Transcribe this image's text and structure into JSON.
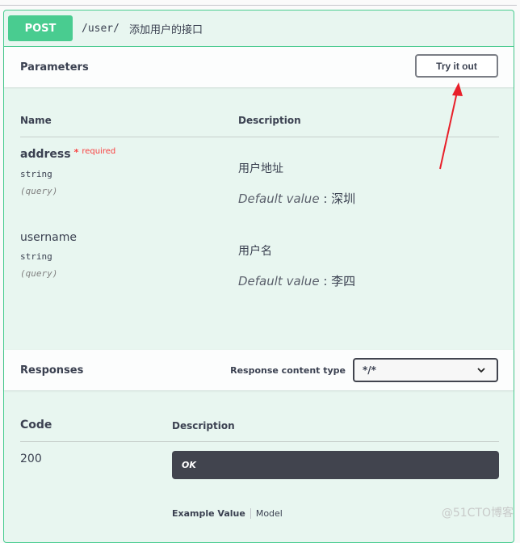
{
  "operation": {
    "method": "POST",
    "path": "/user/",
    "summary": "添加用户的接口",
    "colors": {
      "method_bg": "#49cc90",
      "block_bg": "#e8f6f0",
      "required": "#f93e3e"
    }
  },
  "parameters": {
    "title": "Parameters",
    "try_it_out_label": "Try it out",
    "columns": {
      "name": "Name",
      "description": "Description"
    },
    "items": [
      {
        "name": "address",
        "required_mark": "*",
        "required_label": "required",
        "type": "string",
        "in": "(query)",
        "description": "用户地址",
        "default_label": "Default value",
        "default_value": "深圳"
      },
      {
        "name": "username",
        "type": "string",
        "in": "(query)",
        "description": "用户名",
        "default_label": "Default value",
        "default_value": "李四"
      }
    ]
  },
  "responses": {
    "title": "Responses",
    "content_type_label": "Response content type",
    "content_type_value": "*/*",
    "columns": {
      "code": "Code",
      "description": "Description"
    },
    "items": [
      {
        "code": "200",
        "description": "OK"
      }
    ],
    "example_tabs": {
      "active": "Example Value",
      "other": "Model"
    }
  },
  "watermark": "@51CTO博客"
}
